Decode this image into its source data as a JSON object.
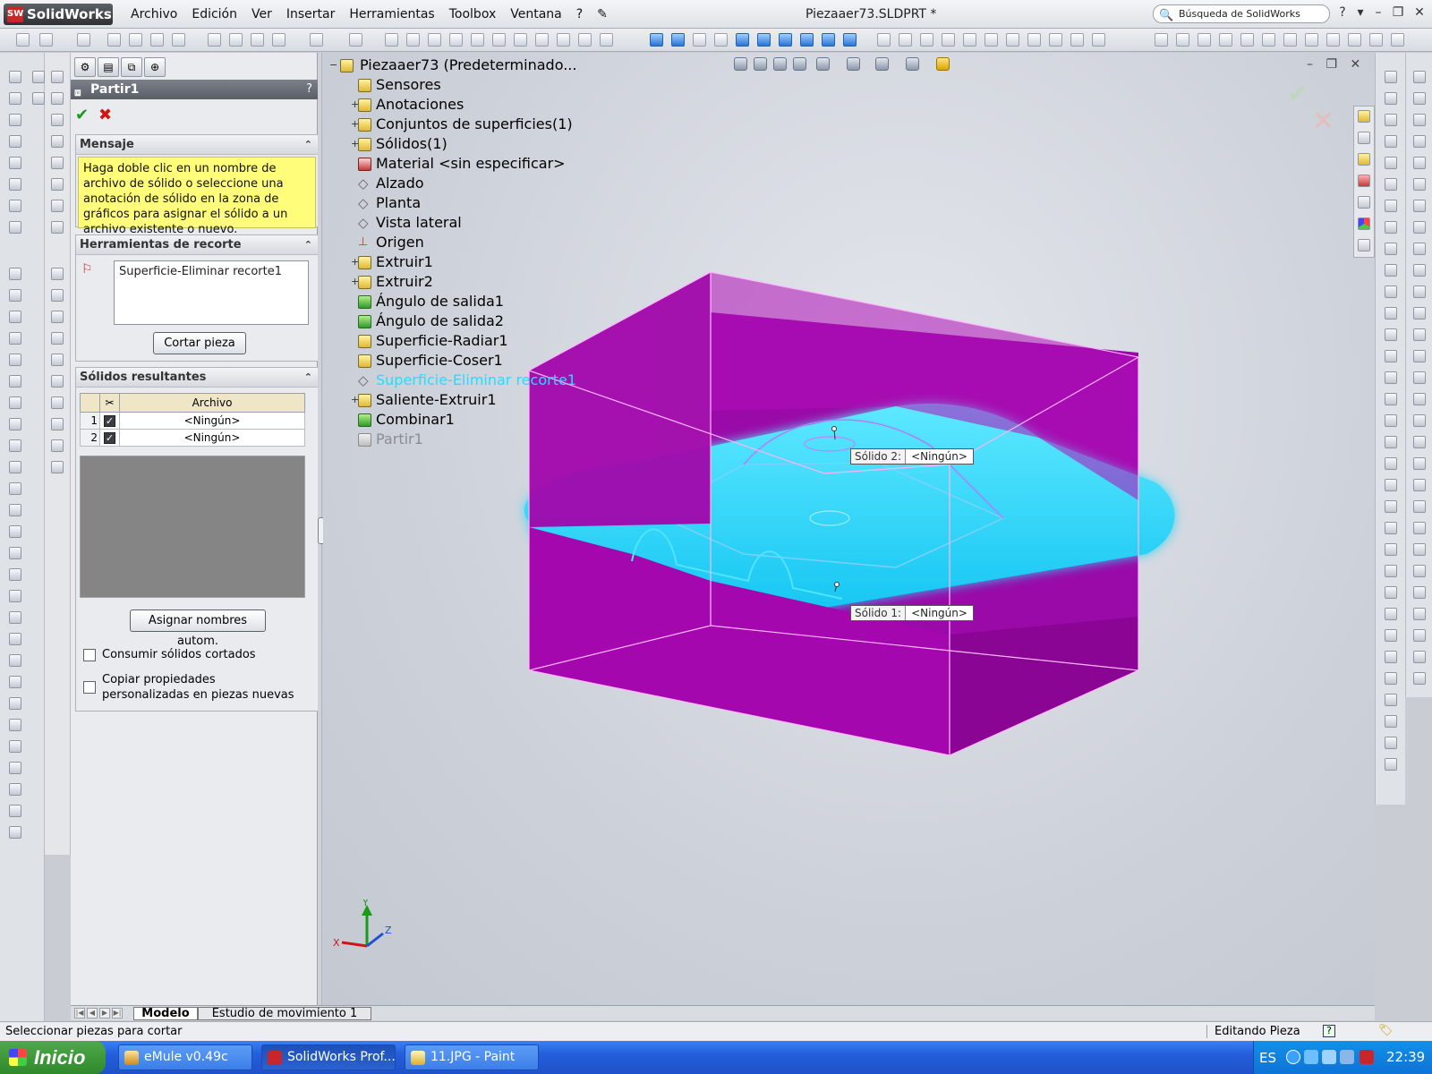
{
  "app": {
    "logo": "SolidWorks",
    "menus": [
      "Archivo",
      "Edición",
      "Ver",
      "Insertar",
      "Herramientas",
      "Toolbox",
      "Ventana",
      "?"
    ],
    "document_title": "Piezaaer73.SLDPRT *",
    "search_placeholder": "Búsqueda de SolidWorks"
  },
  "property_manager": {
    "title": "Partir1",
    "help": "?",
    "message_group": {
      "title": "Mensaje",
      "text": "Haga doble clic en un nombre de archivo de sólido o seleccione una anotación de sólido en la zona de gráficos para asignar el sólido a un archivo existente o nuevo."
    },
    "trim_tools_group": {
      "title": "Herramientas de recorte",
      "selected_tool": "Superficie-Eliminar recorte1",
      "cut_button": "Cortar pieza"
    },
    "results_group": {
      "title": "Sólidos resultantes",
      "column_file": "Archivo",
      "rows": [
        {
          "index": "1",
          "checked": true,
          "file": "<Ningún>"
        },
        {
          "index": "2",
          "checked": true,
          "file": "<Ningún>"
        }
      ],
      "auto_name_button": "Asignar nombres autom.",
      "consume_label": "Consumir sólidos cortados",
      "copy_props_label": "Copiar propiedades personalizadas en piezas nuevas",
      "consume_checked": false,
      "copy_props_checked": false
    }
  },
  "feature_tree": {
    "root": "Piezaaer73  (Predeterminado...",
    "items": [
      {
        "label": "Sensores",
        "expandable": false
      },
      {
        "label": "Anotaciones",
        "expandable": true
      },
      {
        "label": "Conjuntos de superficies(1)",
        "expandable": true
      },
      {
        "label": "Sólidos(1)",
        "expandable": true
      },
      {
        "label": "Material <sin especificar>",
        "expandable": false
      },
      {
        "label": "Alzado",
        "expandable": false
      },
      {
        "label": "Planta",
        "expandable": false
      },
      {
        "label": "Vista lateral",
        "expandable": false
      },
      {
        "label": "Origen",
        "expandable": false
      },
      {
        "label": "Extruir1",
        "expandable": true
      },
      {
        "label": "Extruir2",
        "expandable": true
      },
      {
        "label": "Ángulo de salida1",
        "expandable": false
      },
      {
        "label": "Ángulo de salida2",
        "expandable": false
      },
      {
        "label": "Superficie-Radiar1",
        "expandable": false
      },
      {
        "label": "Superficie-Coser1",
        "expandable": false
      },
      {
        "label": "Superficie-Eliminar recorte1",
        "expandable": false
      },
      {
        "label": "Saliente-Extruir1",
        "expandable": true
      },
      {
        "label": "Combinar1",
        "expandable": false
      },
      {
        "label": "Partir1",
        "expandable": false
      }
    ]
  },
  "callouts": {
    "solid2_label": "Sólido  2:",
    "solid2_value": "<Ningún>",
    "solid1_label": "Sólido  1:",
    "solid1_value": "<Ningún>"
  },
  "triad": {
    "x": "X",
    "y": "Y",
    "z": "Z"
  },
  "tabs": {
    "model": "Modelo",
    "motion": "Estudio de movimiento 1"
  },
  "status": {
    "text": "Seleccionar piezas para cortar",
    "mode": "Editando Pieza"
  },
  "taskbar": {
    "start": "Inicio",
    "tasks": [
      "eMule v0.49c",
      "SolidWorks Prof...",
      "11.JPG - Paint"
    ],
    "language": "ES",
    "clock": "22:39"
  },
  "colors": {
    "body": "#a000a8",
    "surface": "#20d8ff",
    "accent_selected": "#1ee0ff"
  }
}
